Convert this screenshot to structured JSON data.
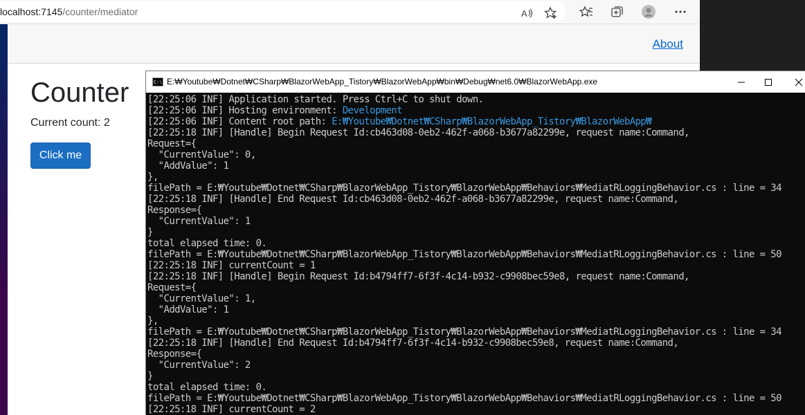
{
  "browser": {
    "url_host": "localhost:7145",
    "url_path": "/counter/mediator",
    "toolbar_icons": [
      "read-aloud-icon",
      "add-favorite-icon",
      "favorites-icon",
      "collections-icon",
      "profile-icon",
      "more-icon"
    ],
    "nav": {
      "about_label": "About"
    },
    "page": {
      "title": "Counter",
      "count_label": "Current count: 2",
      "button_label": "Click me"
    },
    "colors": {
      "sidebar_top": "#052767",
      "sidebar_bottom": "#3a0647",
      "button": "#1b6ec2",
      "link": "#0366d6"
    }
  },
  "console": {
    "title": "E:₩Youtube₩Dotnet₩CSharp₩BlazorWebApp_Tistory₩BlazorWebApp₩bin₩Debug₩net6.0₩BlazorWebApp.exe",
    "icon_label": "C:\\",
    "highlight_color": "#3a96dd",
    "lines": [
      {
        "text": "[22:25:06 INF] Application started. Press Ctrl+C to shut down."
      },
      {
        "text": "[22:25:06 INF] Hosting environment: ",
        "hl": "Development"
      },
      {
        "text": "[22:25:06 INF] Content root path: ",
        "hl": "E:₩Youtube₩Dotnet₩CSharp₩BlazorWebApp_Tistory₩BlazorWebApp₩"
      },
      {
        "text": "[22:25:18 INF] [Handle] Begin Request Id:cb463d08-0eb2-462f-a068-b3677a82299e, request name:Command,"
      },
      {
        "text": "Request={"
      },
      {
        "text": "  \"CurrentValue\": 0,"
      },
      {
        "text": "  \"AddValue\": 1"
      },
      {
        "text": "},"
      },
      {
        "text": "filePath = E:₩Youtube₩Dotnet₩CSharp₩BlazorWebApp_Tistory₩BlazorWebApp₩Behaviors₩MediatRLoggingBehavior.cs : line = 34"
      },
      {
        "text": "[22:25:18 INF] [Handle] End Request Id:cb463d08-0eb2-462f-a068-b3677a82299e, request name:Command,"
      },
      {
        "text": "Response={"
      },
      {
        "text": "  \"CurrentValue\": 1"
      },
      {
        "text": "}"
      },
      {
        "text": "total elapsed time: 0."
      },
      {
        "text": "filePath = E:₩Youtube₩Dotnet₩CSharp₩BlazorWebApp_Tistory₩BlazorWebApp₩Behaviors₩MediatRLoggingBehavior.cs : line = 50"
      },
      {
        "text": "[22:25:18 INF] currentCount = 1"
      },
      {
        "text": "[22:25:18 INF] [Handle] Begin Request Id:b4794ff7-6f3f-4c14-b932-c9908bec59e8, request name:Command,"
      },
      {
        "text": "Request={"
      },
      {
        "text": "  \"CurrentValue\": 1,"
      },
      {
        "text": "  \"AddValue\": 1"
      },
      {
        "text": "},"
      },
      {
        "text": "filePath = E:₩Youtube₩Dotnet₩CSharp₩BlazorWebApp_Tistory₩BlazorWebApp₩Behaviors₩MediatRLoggingBehavior.cs : line = 34"
      },
      {
        "text": "[22:25:18 INF] [Handle] End Request Id:b4794ff7-6f3f-4c14-b932-c9908bec59e8, request name:Command,"
      },
      {
        "text": "Response={"
      },
      {
        "text": "  \"CurrentValue\": 2"
      },
      {
        "text": "}"
      },
      {
        "text": "total elapsed time: 0."
      },
      {
        "text": "filePath = E:₩Youtube₩Dotnet₩CSharp₩BlazorWebApp_Tistory₩BlazorWebApp₩Behaviors₩MediatRLoggingBehavior.cs : line = 50"
      },
      {
        "text": "[22:25:18 INF] currentCount = 2"
      }
    ]
  }
}
